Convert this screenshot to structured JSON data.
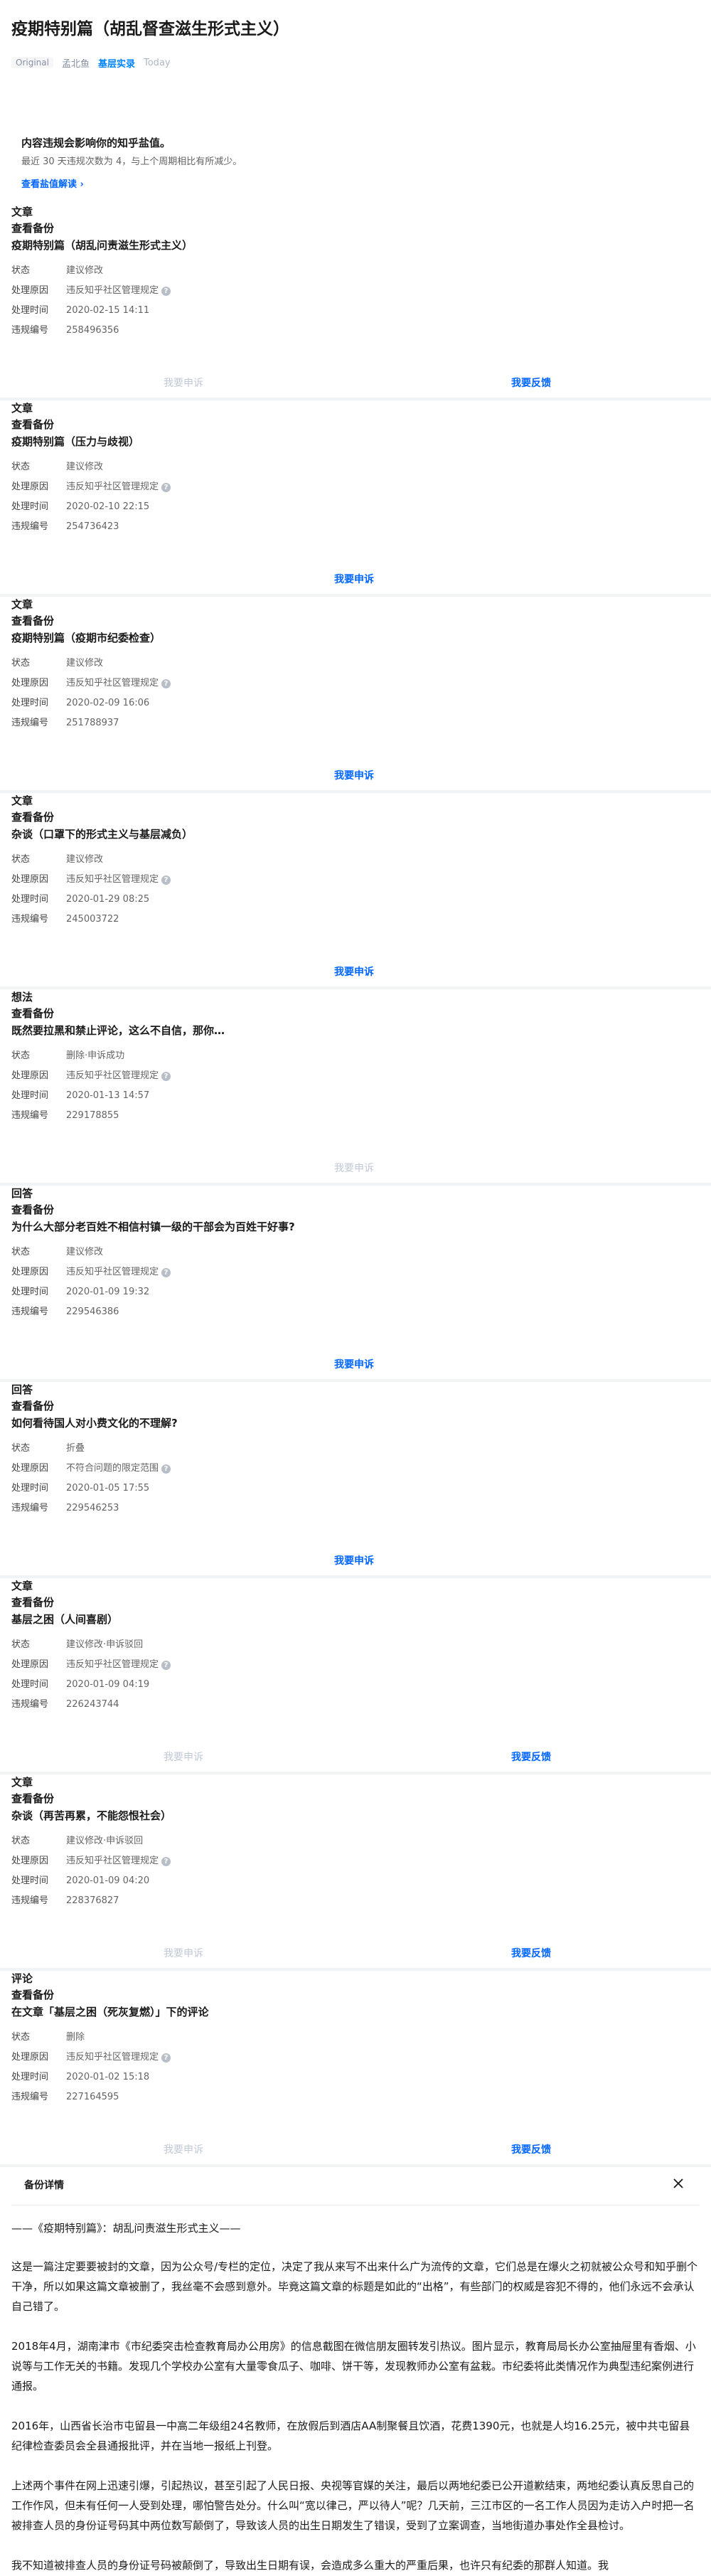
{
  "article": {
    "title": "疫期特别篇（胡乱督查滋生形式主义）",
    "original_badge": "Original",
    "author": "孟北鱼",
    "column": "基层实录",
    "date": "Today"
  },
  "notice": {
    "title": "内容违规会影响你的知乎盐值。",
    "subtitle": "最近 30 天违规次数为 4，与上个周期相比有所减少。",
    "link": "查看盐值解读 ›"
  },
  "labels": {
    "status": "状态",
    "reason": "处理原因",
    "time": "处理时间",
    "id": "违规编号",
    "backup": "查看备份",
    "appeal": "我要申诉",
    "feedback": "我要反馈"
  },
  "records": [
    {
      "type": "文章",
      "title": "疫期特别篇（胡乱问责滋生形式主义）",
      "status": "建议修改",
      "reason": "违反知乎社区管理规定",
      "time": "2020-02-15 14:11",
      "id": "258496356",
      "appeal_enabled": false,
      "feedback": true
    },
    {
      "type": "文章",
      "title": "疫期特别篇（压力与歧视）",
      "status": "建议修改",
      "reason": "违反知乎社区管理规定",
      "time": "2020-02-10 22:15",
      "id": "254736423",
      "appeal_enabled": true,
      "feedback": false
    },
    {
      "type": "文章",
      "title": "疫期特别篇（疫期市纪委检查）",
      "status": "建议修改",
      "reason": "违反知乎社区管理规定",
      "time": "2020-02-09 16:06",
      "id": "251788937",
      "appeal_enabled": true,
      "feedback": false
    },
    {
      "type": "文章",
      "title": "杂谈（口罩下的形式主义与基层减负）",
      "status": "建议修改",
      "reason": "违反知乎社区管理规定",
      "time": "2020-01-29 08:25",
      "id": "245003722",
      "appeal_enabled": true,
      "feedback": false
    },
    {
      "type": "想法",
      "title": "既然要拉黑和禁止评论，这么不自信，那你…",
      "status": "删除·申诉成功",
      "reason": "违反知乎社区管理规定",
      "time": "2020-01-13 14:57",
      "id": "229178855",
      "appeal_enabled": false,
      "feedback": false
    },
    {
      "type": "回答",
      "title": "为什么大部分老百姓不相信村镇一级的干部会为百姓干好事?",
      "status": "建议修改",
      "reason": "违反知乎社区管理规定",
      "time": "2020-01-09 19:32",
      "id": "229546386",
      "appeal_enabled": true,
      "feedback": false
    },
    {
      "type": "回答",
      "title": "如何看待国人对小费文化的不理解?",
      "status": "折叠",
      "reason": "不符合问题的限定范围",
      "time": "2020-01-05 17:55",
      "id": "229546253",
      "appeal_enabled": true,
      "feedback": false
    },
    {
      "type": "文章",
      "title": "基层之困（人间喜剧）",
      "status": "建议修改·申诉驳回",
      "reason": "违反知乎社区管理规定",
      "time": "2020-01-09 04:19",
      "id": "226243744",
      "appeal_enabled": false,
      "feedback": true
    },
    {
      "type": "文章",
      "title": "杂谈（再苦再累，不能怨恨社会）",
      "status": "建议修改·申诉驳回",
      "reason": "违反知乎社区管理规定",
      "time": "2020-01-09 04:20",
      "id": "228376827",
      "appeal_enabled": false,
      "feedback": true
    },
    {
      "type": "评论",
      "title": "在文章「基层之困（死灰复燃）」下的评论",
      "status": "删除",
      "reason": "违反知乎社区管理规定",
      "time": "2020-01-02 15:18",
      "id": "227164595",
      "appeal_enabled": false,
      "feedback": true
    }
  ],
  "modal": {
    "title": "备份详情",
    "heading": "——《疫期特别篇》：胡乱问责滋生形式主义——",
    "paragraphs": [
      "这是一篇注定要要被封的文章，因为公众号/专栏的定位，决定了我从来写不出来什么广为流传的文章，它们总是在爆火之初就被公众号和知乎删个干净，所以如果这篇文章被删了，我丝毫不会感到意外。毕竟这篇文章的标题是如此的“出格”，有些部门的权威是容犯不得的，他们永远不会承认自己错了。",
      "2018年4月，湖南津市《市纪委突击检查教育局办公用房》的信息截图在微信朋友圈转发引热议。图片显示，教育局局长办公室抽屉里有香烟、小说等与工作无关的书籍。发现几个学校办公室有大量零食瓜子、咖啡、饼干等，发现教师办公室有盆栽。市纪委将此类情况作为典型违纪案例进行通报。",
      "2016年，山西省长治市屯留县一中高二年级组24名教师，在放假后到酒店AA制聚餐且饮酒，花费1390元，也就是人均16.25元，被中共屯留县纪律检查委员会全县通报批评，并在当地一报纸上刊登。",
      "上述两个事件在网上迅速引爆，引起热议，甚至引起了人民日报、央视等官媒的关注，最后以两地纪委已公开道歉结束，两地纪委认真反思自己的工作作风，但未有任何一人受到处理，哪怕警告处分。什么叫“宽以律己，严以待人”呢？几天前，三江市区的一名工作人员因为走访入户时把一名被排查人员的身份证号码其中两位数写颠倒了，导致该人员的出生日期发生了错误，受到了立案调查，当地街道办事处作全县检讨。",
      "我不知道被排查人员的身份证号码被颠倒了，导致出生日期有误，会造成多么重大的严重后果，也许只有纪委的那群人知道。我"
    ]
  }
}
